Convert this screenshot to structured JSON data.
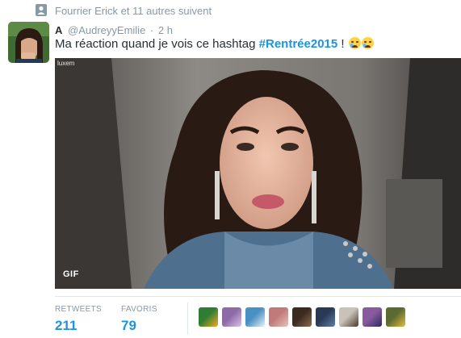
{
  "context": {
    "text": "Fourrier Erick et 11 autres suivent",
    "icon": "person-icon"
  },
  "tweet": {
    "author_name": "A",
    "author_handle": "@AudreyyEmilie",
    "separator": "·",
    "time": "2 h",
    "text_before": "Ma réaction quand je vois ce hashtag ",
    "hashtag": "#Rentrée2015",
    "text_after": " !",
    "emojis": [
      "crying-face-icon",
      "crying-face-icon"
    ]
  },
  "media": {
    "watermark": "luxem",
    "badge": "GIF"
  },
  "stats": {
    "retweets_label": "RETWEETS",
    "retweets_count": "211",
    "favorites_label": "FAVORIS",
    "favorites_count": "79"
  },
  "favoriters": [
    {
      "colors": [
        "#2e7d32",
        "#f9a825"
      ]
    },
    {
      "colors": [
        "#8e6aa8",
        "#d8c3e6"
      ]
    },
    {
      "colors": [
        "#4a90c2",
        "#e8f1f8"
      ]
    },
    {
      "colors": [
        "#c07a7a",
        "#e8c1b8"
      ]
    },
    {
      "colors": [
        "#3b2a20",
        "#8a6a50"
      ]
    },
    {
      "colors": [
        "#2a3a55",
        "#5d7fa8"
      ]
    },
    {
      "colors": [
        "#c9c2b8",
        "#4a3a2a"
      ]
    },
    {
      "colors": [
        "#8a5aa0",
        "#2a2a60"
      ]
    },
    {
      "colors": [
        "#5a6a30",
        "#e0c040"
      ]
    }
  ],
  "colors": {
    "link": "#1b95e0",
    "muted": "#8899a6",
    "text": "#292f33"
  }
}
